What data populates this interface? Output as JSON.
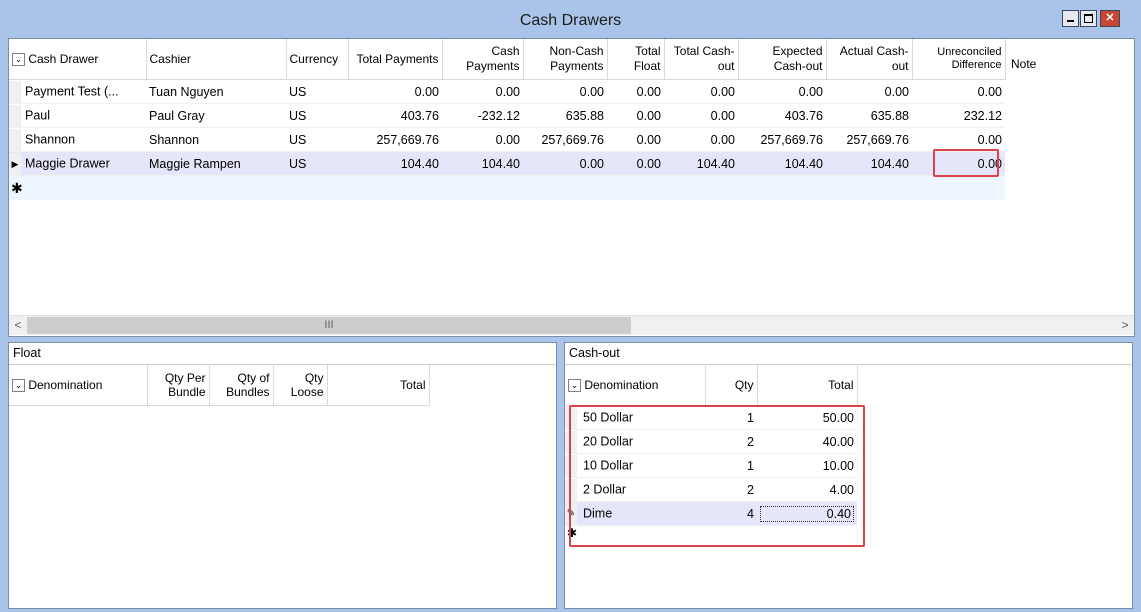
{
  "window": {
    "title": "Cash Drawers"
  },
  "main_grid": {
    "columns": [
      "Cash Drawer",
      "Cashier",
      "Currency",
      "Total Payments",
      "Cash Payments",
      "Non-Cash Payments",
      "Total Float",
      "Total Cash-out",
      "Expected Cash-out",
      "Actual Cash-out",
      "Unreconciled Difference",
      "Note"
    ],
    "rows": [
      [
        "Payment Test (...",
        "Tuan Nguyen",
        "US",
        "0.00",
        "0.00",
        "0.00",
        "0.00",
        "0.00",
        "0.00",
        "0.00",
        "0.00",
        ""
      ],
      [
        "Paul",
        "Paul Gray",
        "US",
        "403.76",
        "-232.12",
        "635.88",
        "0.00",
        "0.00",
        "403.76",
        "635.88",
        "232.12",
        ""
      ],
      [
        "Shannon",
        "Shannon",
        "US",
        "257,669.76",
        "0.00",
        "257,669.76",
        "0.00",
        "0.00",
        "257,669.76",
        "257,669.76",
        "0.00",
        ""
      ],
      [
        "Maggie Drawer",
        "Maggie Rampen",
        "US",
        "104.40",
        "104.40",
        "0.00",
        "0.00",
        "104.40",
        "104.40",
        "104.40",
        "0.00",
        ""
      ]
    ],
    "selected_row": 3,
    "scroll_thumb_glyph": "III"
  },
  "float_panel": {
    "title": "Float",
    "columns": [
      "Denomination",
      "Qty Per Bundle",
      "Qty of Bundles",
      "Qty Loose",
      "Total"
    ]
  },
  "cashout_panel": {
    "title": "Cash-out",
    "columns": [
      "Denomination",
      "Qty",
      "Total"
    ],
    "rows": [
      [
        "50 Dollar",
        "1",
        "50.00"
      ],
      [
        "20 Dollar",
        "2",
        "40.00"
      ],
      [
        "10 Dollar",
        "1",
        "10.00"
      ],
      [
        "2 Dollar",
        "2",
        "4.00"
      ],
      [
        "Dime",
        "4",
        "0.40"
      ]
    ],
    "editing_row": 4
  },
  "colors": {
    "highlight": "#d9434a",
    "selected_row": "#e6e6fa",
    "frame": "#a9c4e8"
  }
}
